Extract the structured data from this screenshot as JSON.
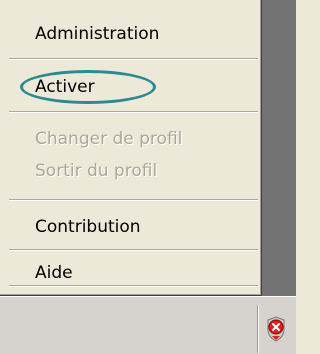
{
  "menu": {
    "items": [
      {
        "label": "Administration",
        "enabled": true
      },
      {
        "label": "Activer",
        "enabled": true,
        "highlighted": true
      },
      {
        "label": "Changer de profil",
        "enabled": false
      },
      {
        "label": "Sortir du profil",
        "enabled": false
      },
      {
        "label": "Contribution",
        "enabled": true
      },
      {
        "label": "Aide",
        "enabled": true
      }
    ]
  },
  "annotation": {
    "color": "#2a8a94"
  },
  "tray": {
    "icon": "red-alert-tray-icon",
    "icon_color": "#e02020"
  }
}
